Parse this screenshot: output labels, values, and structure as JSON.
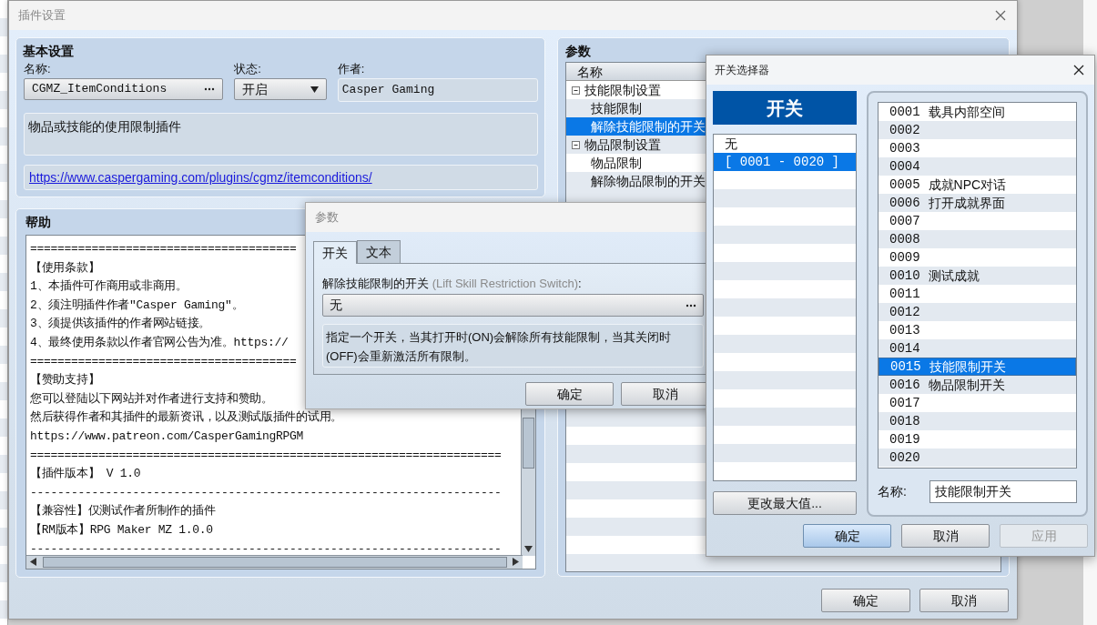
{
  "window": {
    "title": "插件设置"
  },
  "basic_settings": {
    "title": "基本设置",
    "name_label": "名称:",
    "name_value": "CGMZ_ItemConditions",
    "status_label": "状态:",
    "status_value": "开启",
    "author_label": "作者:",
    "author_value": "Casper Gaming",
    "description": "物品或技能的使用限制插件",
    "url": "https://www.caspergaming.com/plugins/cgmz/itemconditions/"
  },
  "help": {
    "title": "帮助",
    "lines": [
      "=======================================",
      "【使用条款】",
      "1、本插件可作商用或非商用。",
      "2、须注明插件作者\"Casper Gaming\"。",
      "3、须提供该插件的作者网站链接。",
      "4、最终使用条款以作者官网公告为准。https://",
      "=======================================",
      "【赞助支持】",
      "您可以登陆以下网站并对作者进行支持和赞助。",
      "然后获得作者和其插件的最新资讯，以及测试版插件的试用。",
      "https://www.patreon.com/CasperGamingRPGM",
      "=====================================================================",
      "【插件版本】 V 1.0",
      "---------------------------------------------------------------------",
      "【兼容性】仅测试作者所制作的插件",
      "【RM版本】RPG Maker MZ 1.0.0",
      "---------------------------------------------------------------------"
    ]
  },
  "parameters": {
    "title": "参数",
    "column": "名称",
    "tree": [
      {
        "label": "技能限制设置",
        "expanded": true,
        "selected": false,
        "children": [
          {
            "label": "技能限制",
            "selected": false
          },
          {
            "label": "解除技能限制的开关",
            "selected": true
          }
        ]
      },
      {
        "label": "物品限制设置",
        "expanded": true,
        "selected": false,
        "children": [
          {
            "label": "物品限制",
            "selected": false
          },
          {
            "label": "解除物品限制的开关",
            "selected": false
          }
        ]
      }
    ]
  },
  "buttons": [
    "确定",
    "取消"
  ],
  "param_dialog": {
    "title": "参数",
    "tabs": [
      {
        "label": "开关",
        "selected": true
      },
      {
        "label": "文本",
        "selected": false
      }
    ],
    "label": "解除技能限制的开关",
    "label_note": "(Lift Skill Restriction Switch)",
    "label_suffix": ":",
    "value": "无",
    "description": "指定一个开关，当其打开时(ON)会解除所有技能限制，当其关闭时(OFF)会重新激活所有限制。",
    "buttons": [
      "确定",
      "取消"
    ]
  },
  "switch_selector": {
    "title": "开关选择器",
    "header": "开关",
    "groups": [
      {
        "label": "无",
        "selected": false
      },
      {
        "label": "[ 0001 - 0020 ]",
        "selected": true
      }
    ],
    "change_max_button": "更改最大值...",
    "switches": [
      {
        "id": "0001",
        "name": "载具内部空间",
        "selected": false
      },
      {
        "id": "0002",
        "selected": false
      },
      {
        "id": "0003",
        "selected": false
      },
      {
        "id": "0004",
        "selected": false
      },
      {
        "id": "0005",
        "name": "成就NPC对话",
        "selected": false
      },
      {
        "id": "0006",
        "name": "打开成就界面",
        "selected": false
      },
      {
        "id": "0007",
        "selected": false
      },
      {
        "id": "0008",
        "selected": false
      },
      {
        "id": "0009",
        "selected": false
      },
      {
        "id": "0010",
        "name": "测试成就",
        "selected": false
      },
      {
        "id": "0011",
        "selected": false
      },
      {
        "id": "0012",
        "selected": false
      },
      {
        "id": "0013",
        "selected": false
      },
      {
        "id": "0014",
        "selected": false
      },
      {
        "id": "0015",
        "name": "技能限制开关",
        "selected": true
      },
      {
        "id": "0016",
        "name": "物品限制开关",
        "selected": false
      },
      {
        "id": "0017",
        "selected": false
      },
      {
        "id": "0018",
        "selected": false
      },
      {
        "id": "0019",
        "selected": false
      },
      {
        "id": "0020",
        "selected": false
      }
    ],
    "name_label": "名称:",
    "name_value": "技能限制开关",
    "buttons": [
      {
        "label": "确定",
        "default": true,
        "disabled": false
      },
      {
        "label": "取消",
        "default": false,
        "disabled": false
      },
      {
        "label": "应用",
        "default": false,
        "disabled": true
      }
    ]
  }
}
